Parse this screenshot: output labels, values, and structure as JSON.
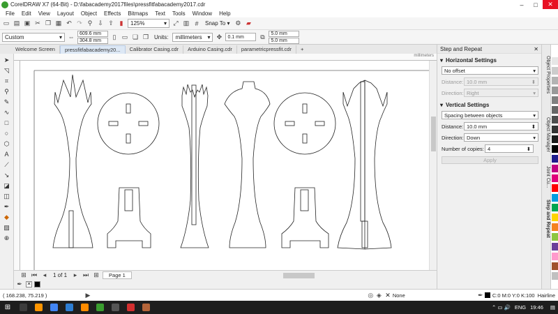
{
  "window": {
    "title": "CorelDRAW X7 (64-Bit) - D:\\fabacademy2017files\\pressfitfabacademy2017.cdr",
    "min": "–",
    "max": "□",
    "close": "✕"
  },
  "menu": [
    "File",
    "Edit",
    "View",
    "Layout",
    "Object",
    "Effects",
    "Bitmaps",
    "Text",
    "Tools",
    "Window",
    "Help"
  ],
  "toolbar": {
    "zoom": "125%",
    "snap": "Snap To"
  },
  "propbar": {
    "preset": "Custom",
    "width": "609.6 mm",
    "height": "304.8 mm",
    "units_label": "Units:",
    "units": "millimeters",
    "nudge": "0.1 mm",
    "dup_x": "5.0 mm",
    "dup_y": "5.0 mm"
  },
  "tabs": [
    "Welcome Screen",
    "pressfitfabacademy20...",
    "Calibrator Casing.cdr",
    "Arduino Casing.cdr",
    "parametricpressfit.cdr"
  ],
  "ruler_unit": "millimeters",
  "pagenav": {
    "counter": "1 of 1",
    "page": "Page 1"
  },
  "docker": {
    "title": "Step and Repeat",
    "horizontal": {
      "heading": "Horizontal Settings",
      "mode": "No offset",
      "distance_label": "Distance:",
      "distance": "10.0 mm",
      "direction_label": "Direction:",
      "direction": "Right"
    },
    "vertical": {
      "heading": "Vertical Settings",
      "mode": "Spacing between objects",
      "distance_label": "Distance:",
      "distance": "10.0 mm",
      "direction_label": "Direction:",
      "direction": "Down"
    },
    "copies_label": "Number of copies:",
    "copies": "4",
    "apply": "Apply"
  },
  "docker_tabs": [
    "Object Properties",
    "Object Manager",
    "Joint Cu...",
    "Step and Repeat"
  ],
  "palette": [
    "#ffffff",
    "#e6e6e6",
    "#cccccc",
    "#b3b3b3",
    "#999999",
    "#808080",
    "#666666",
    "#4d4d4d",
    "#333333",
    "#1a1a1a",
    "#000000",
    "#1f1a8c",
    "#c00080",
    "#e0007a",
    "#ff0000",
    "#009ee0",
    "#00a651",
    "#ffd400",
    "#f58220",
    "#8dc63f",
    "#6a3d9a",
    "#ff99cc",
    "#a0522d",
    "#c0c0c0"
  ],
  "status": {
    "coords": "( 168.238, 75.219 )",
    "fill": "None",
    "outline": "C:0 M:0 Y:0 K:100",
    "outline_width": "Hairline"
  },
  "taskbar": {
    "lang": "ENG",
    "time": "19:46",
    "apps": [
      "#3c3c3c",
      "#ff9500",
      "#4285f4",
      "#2d7dd2",
      "#cc3333",
      "#ff8c00",
      "#3a9d2f",
      "#555555",
      "#d32f2f",
      "#b5653a"
    ]
  }
}
